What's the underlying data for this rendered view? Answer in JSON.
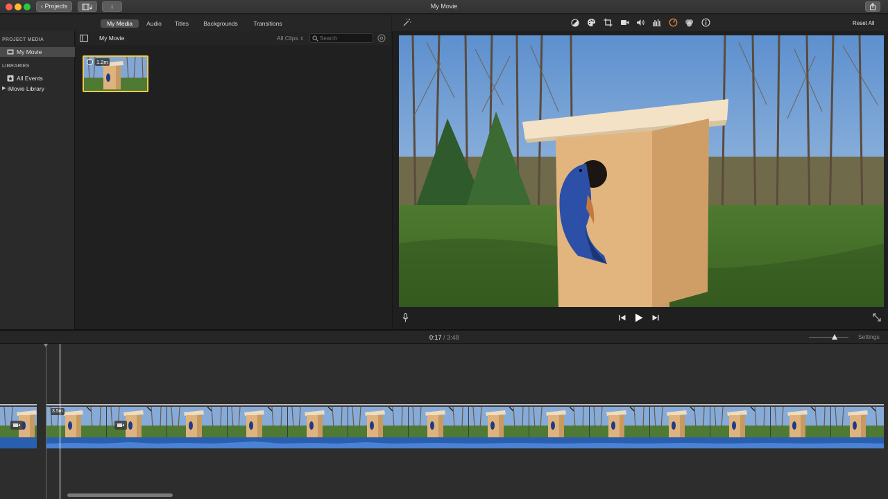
{
  "window": {
    "title": "My Movie",
    "projects_label": "Projects"
  },
  "browser_tabs": [
    {
      "label": "My Media",
      "active": true
    },
    {
      "label": "Audio",
      "active": false
    },
    {
      "label": "Titles",
      "active": false
    },
    {
      "label": "Backgrounds",
      "active": false
    },
    {
      "label": "Transitions",
      "active": false
    }
  ],
  "sidebar": {
    "project_media_header": "PROJECT MEDIA",
    "project_item": "My Movie",
    "libraries_header": "LIBRARIES",
    "all_events": "All Events",
    "library": "iMovie Library"
  },
  "media_browser": {
    "title": "My Movie",
    "filter": "All Clips",
    "search_placeholder": "Search",
    "clip_duration": "1.2m"
  },
  "viewer": {
    "reset_all": "Reset All",
    "tools": [
      "color-balance-icon",
      "color-correction-icon",
      "crop-icon",
      "stabilization-icon",
      "volume-icon",
      "noise-reduction-icon",
      "speed-icon",
      "clip-filter-icon",
      "info-icon"
    ]
  },
  "timeline": {
    "current_time": "0:17",
    "separator": "/",
    "total_time": "3:48",
    "settings_label": "Settings",
    "clip_duration": "3.5m"
  },
  "colors": {
    "accent_yellow": "#f2c94c",
    "audio_blue": "#2a5fb0",
    "playhead": "#ffffff"
  }
}
